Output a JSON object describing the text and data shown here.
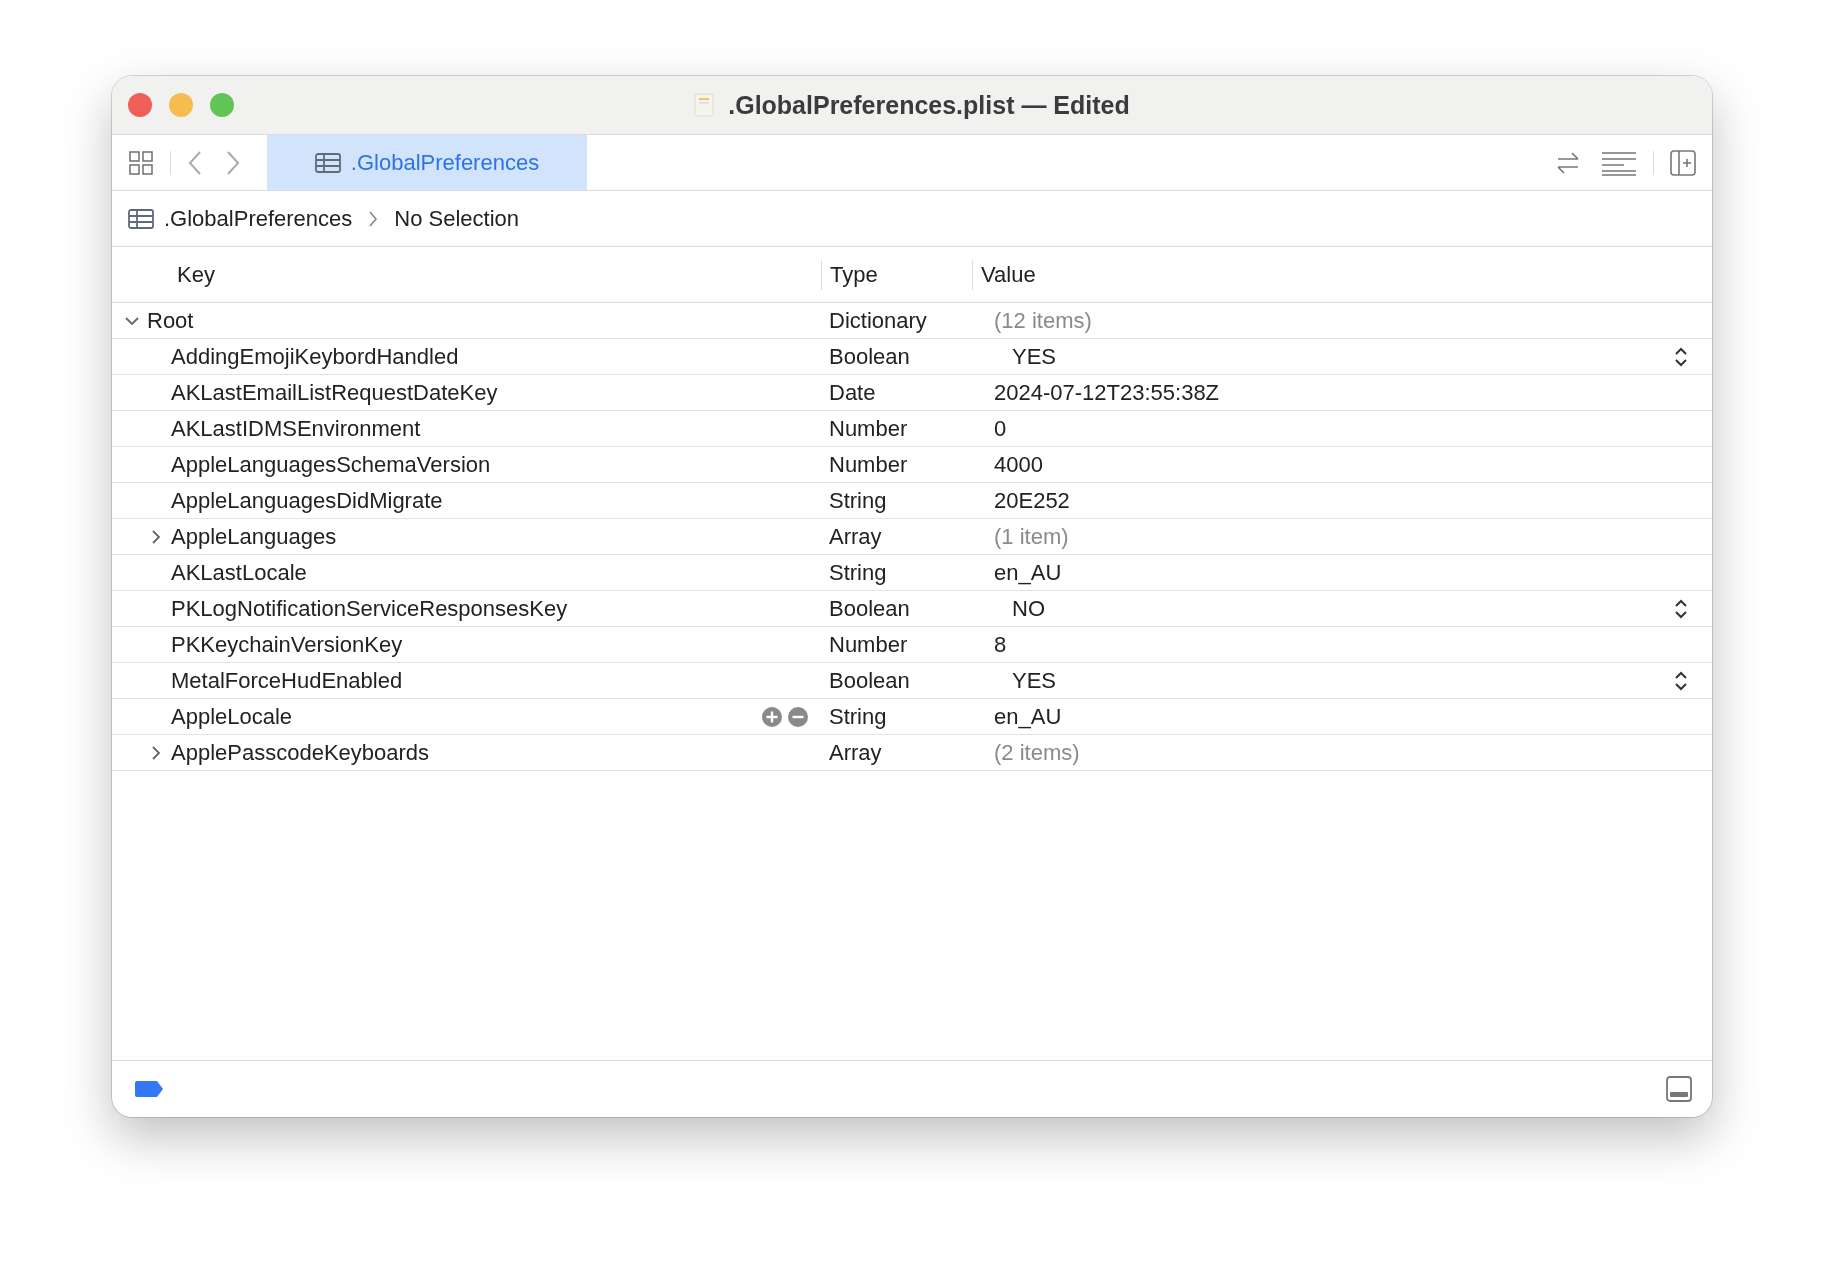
{
  "window": {
    "title": ".GlobalPreferences.plist — Edited"
  },
  "tabs": [
    {
      "label": ".GlobalPreferences",
      "selected": true
    }
  ],
  "breadcrumb": [
    ".GlobalPreferences",
    "No Selection"
  ],
  "table": {
    "columns": [
      "Key",
      "Type",
      "Value"
    ],
    "rows": [
      {
        "key": "Root",
        "type": "Dictionary",
        "value": "(12 items)",
        "kind": "container",
        "expanded": true,
        "hovered": false,
        "children": [
          {
            "key": "AddingEmojiKeybordHandled",
            "type": "Boolean",
            "value": "YES",
            "kind": "boolean",
            "hovered": false
          },
          {
            "key": "AKLastEmailListRequestDateKey",
            "type": "Date",
            "value": "2024-07-12T23:55:38Z",
            "kind": "scalar",
            "hovered": false
          },
          {
            "key": "AKLastIDMSEnvironment",
            "type": "Number",
            "value": "0",
            "kind": "scalar",
            "hovered": false
          },
          {
            "key": "AppleLanguagesSchemaVersion",
            "type": "Number",
            "value": "4000",
            "kind": "scalar",
            "hovered": false
          },
          {
            "key": "AppleLanguagesDidMigrate",
            "type": "String",
            "value": "20E252",
            "kind": "scalar",
            "hovered": false
          },
          {
            "key": "AppleLanguages",
            "type": "Array",
            "value": "(1 item)",
            "kind": "container",
            "expanded": false,
            "hovered": false
          },
          {
            "key": "AKLastLocale",
            "type": "String",
            "value": "en_AU",
            "kind": "scalar",
            "hovered": false
          },
          {
            "key": "PKLogNotificationServiceResponsesKey",
            "type": "Boolean",
            "value": "NO",
            "kind": "boolean",
            "hovered": false
          },
          {
            "key": "PKKeychainVersionKey",
            "type": "Number",
            "value": "8",
            "kind": "scalar",
            "hovered": false
          },
          {
            "key": "MetalForceHudEnabled",
            "type": "Boolean",
            "value": "YES",
            "kind": "boolean",
            "hovered": false
          },
          {
            "key": "AppleLocale",
            "type": "String",
            "value": "en_AU",
            "kind": "scalar",
            "hovered": true
          },
          {
            "key": "ApplePasscodeKeyboards",
            "type": "Array",
            "value": "(2 items)",
            "kind": "container",
            "expanded": false,
            "hovered": false
          }
        ]
      }
    ]
  }
}
